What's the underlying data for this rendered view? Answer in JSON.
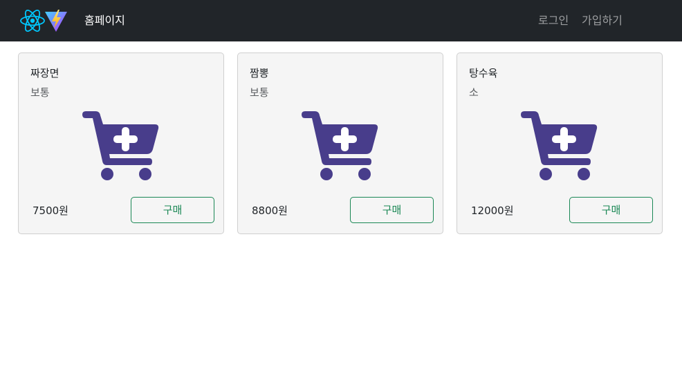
{
  "navbar": {
    "brand": "홈페이지",
    "login": "로그인",
    "signup": "가입하기",
    "icons": [
      "react-icon",
      "vite-icon"
    ]
  },
  "products": [
    {
      "name": "짜장면",
      "spice": "보통",
      "price": "7500원",
      "button": "구매",
      "icon": "cart-plus-icon"
    },
    {
      "name": "짬뽕",
      "spice": "보통",
      "price": "8800원",
      "button": "구매",
      "icon": "cart-plus-icon"
    },
    {
      "name": "탕수육",
      "spice": "소",
      "price": "12000원",
      "button": "구매",
      "icon": "cart-plus-icon"
    }
  ],
  "colors": {
    "navbar": "#212529",
    "cart_icon": "#483d8b",
    "button": "#198754",
    "card_bg": "#f5f5f5"
  }
}
